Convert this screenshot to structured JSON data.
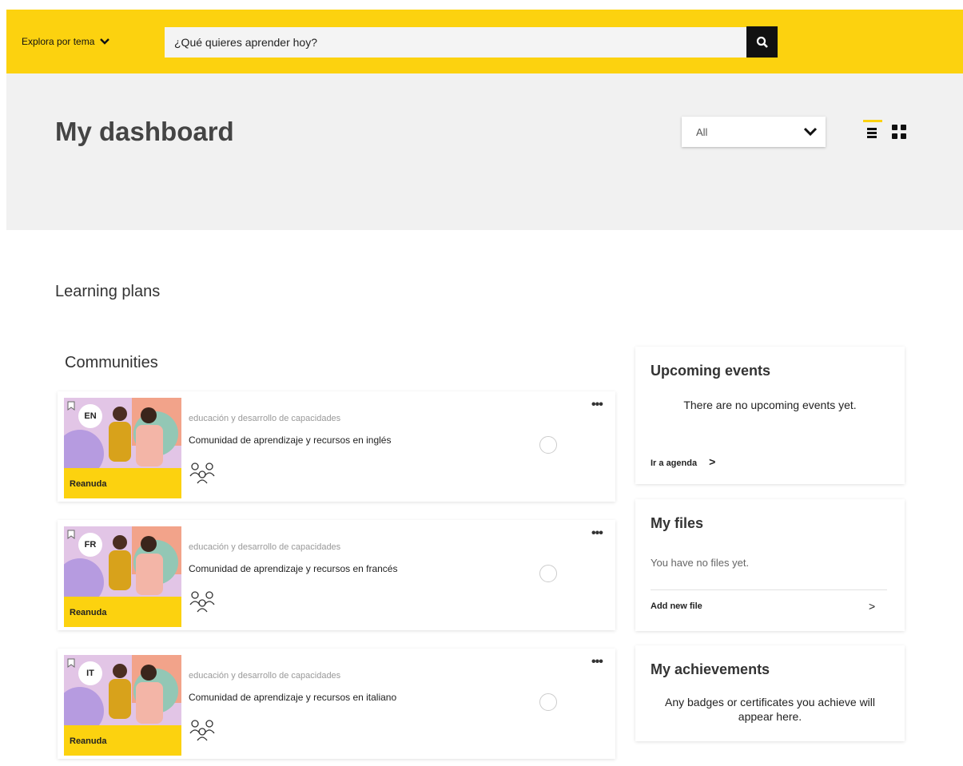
{
  "header": {
    "explore_label": "Explora por tema",
    "search_placeholder": "¿Qué quieres aprender hoy?",
    "accent_color": "#fcd20f"
  },
  "hero": {
    "title": "My dashboard",
    "filter_value": "All"
  },
  "learning_plans": {
    "title": "Learning plans"
  },
  "communities": {
    "title": "Communities",
    "items": [
      {
        "lang": "EN",
        "category": "educación y desarrollo de capacidades",
        "name": "Comunidad de aprendizaje y recursos en inglés",
        "action": "Reanuda"
      },
      {
        "lang": "FR",
        "category": "educación y desarrollo de capacidades",
        "name": "Comunidad de aprendizaje y recursos en francés",
        "action": "Reanuda"
      },
      {
        "lang": "IT",
        "category": "educación y desarrollo de capacidades",
        "name": "Comunidad de aprendizaje y recursos en italiano",
        "action": "Reanuda"
      }
    ]
  },
  "upcoming_events": {
    "title": "Upcoming events",
    "message": "There are no upcoming events yet.",
    "link": "Ir a agenda"
  },
  "my_files": {
    "title": "My files",
    "message": "You have no files yet.",
    "link": "Add new file"
  },
  "my_achievements": {
    "title": "My achievements",
    "message": "Any badges or certificates you achieve will appear here."
  }
}
